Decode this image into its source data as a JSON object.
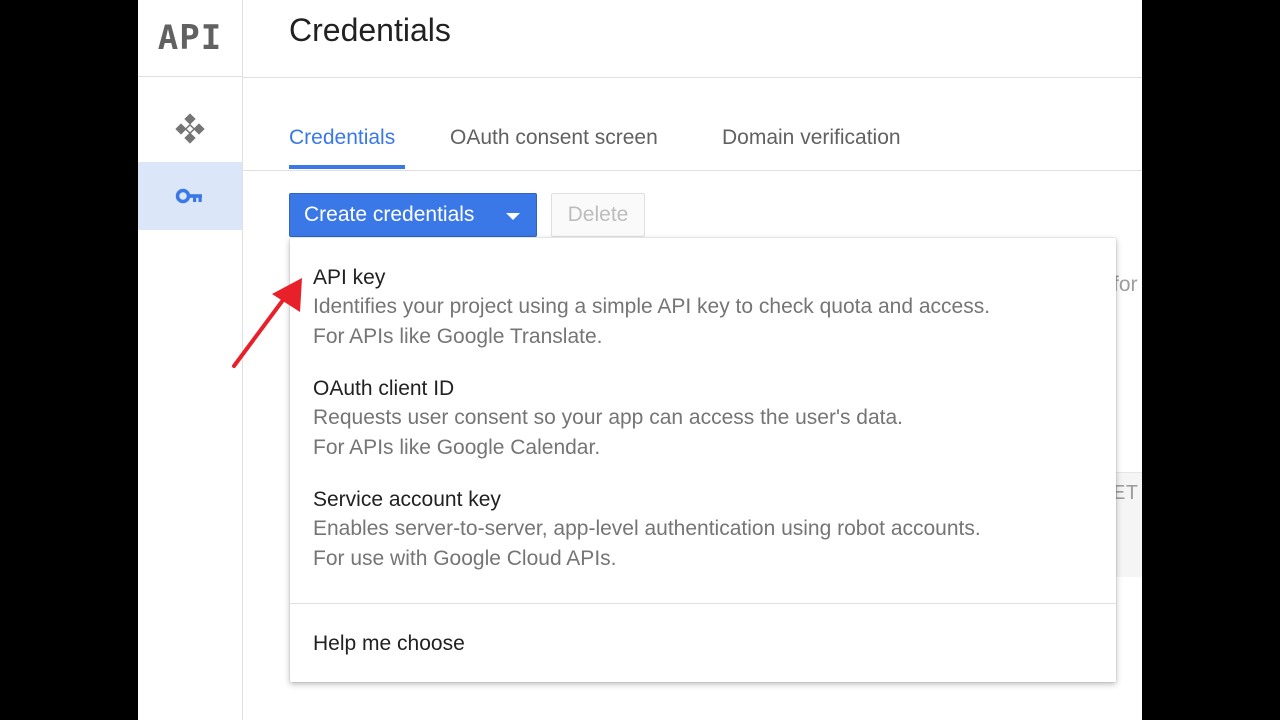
{
  "sidebar": {
    "logo": "API",
    "items": [
      {
        "icon": "apis-diamond-icon"
      },
      {
        "icon": "key-icon"
      }
    ]
  },
  "header": {
    "title": "Credentials"
  },
  "tabs": [
    {
      "label": "Credentials"
    },
    {
      "label": "OAuth consent screen"
    },
    {
      "label": "Domain verification"
    }
  ],
  "toolbar": {
    "create_label": "Create credentials",
    "delete_label": "Delete"
  },
  "background": {
    "fragment_top": "for",
    "fragment_bottom": "ET"
  },
  "menu": {
    "items": [
      {
        "title": "API key",
        "desc1": "Identifies your project using a simple API key to check quota and access.",
        "desc2": "For APIs like Google Translate."
      },
      {
        "title": "OAuth client ID",
        "desc1": "Requests user consent so your app can access the user's data.",
        "desc2": "For APIs like Google Calendar."
      },
      {
        "title": "Service account key",
        "desc1": "Enables server-to-server, app-level authentication using robot accounts.",
        "desc2": "For use with Google Cloud APIs."
      }
    ],
    "help_label": "Help me choose"
  },
  "colors": {
    "accent": "#3b78e7",
    "sidebar_selected": "#dbe6f9",
    "annotation_arrow": "#e8202a"
  }
}
